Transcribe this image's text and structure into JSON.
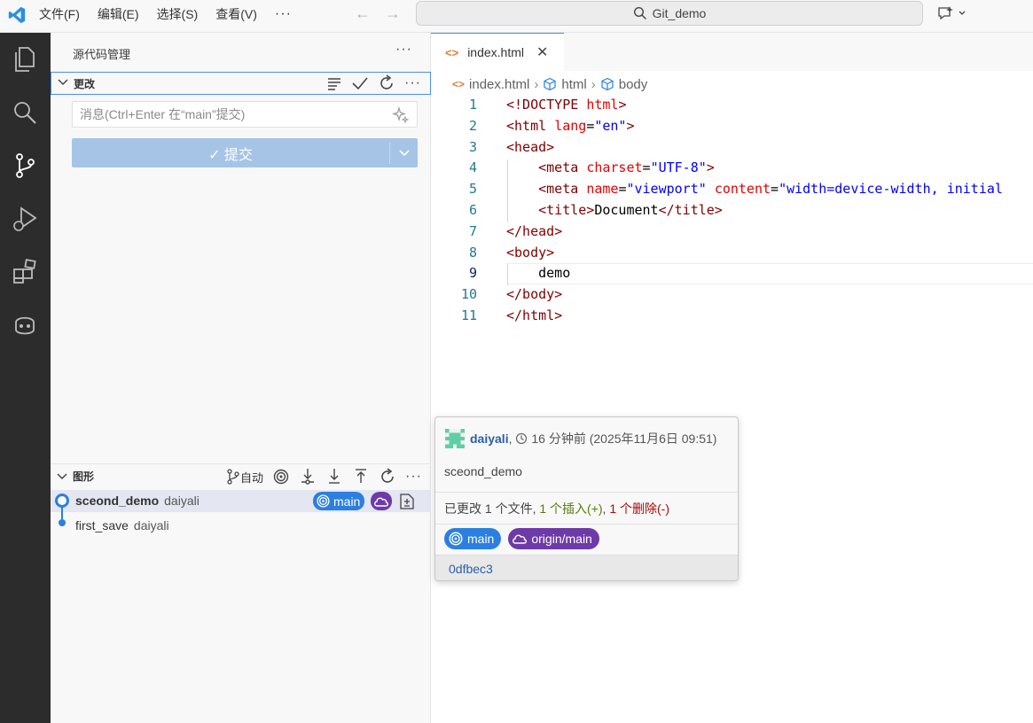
{
  "titlebar": {
    "menu": [
      "文件(F)",
      "编辑(E)",
      "选择(S)",
      "查看(V)"
    ],
    "more": "···",
    "search_text": "Git_demo"
  },
  "sidebar": {
    "title": "源代码管理",
    "more": "···",
    "changes_label": "更改",
    "message_placeholder": "消息(Ctrl+Enter 在“main”提交)",
    "commit_label": "✓ 提交",
    "graph_label": "图形",
    "graph_auto": "自动",
    "commits": [
      {
        "message": "sceond_demo",
        "author": "daiyali",
        "branch": "main"
      },
      {
        "message": "first_save",
        "author": "daiyali"
      }
    ]
  },
  "editor": {
    "tab_label": "index.html",
    "tab_close": "✕",
    "breadcrumb": [
      "index.html",
      "html",
      "body"
    ],
    "current_line": 9
  },
  "hover": {
    "author": "daiyali",
    "time": "16 分钟前 (2025年11月6日 09:51)",
    "message": "sceond_demo",
    "stats_prefix": "已更改 1 个文件, ",
    "stats_ins": "1 个插入(+)",
    "stats_sep": ", ",
    "stats_del": "1 个删除(-)",
    "badge_main": "main",
    "badge_origin": "origin/main",
    "hash": "0dfbec3"
  },
  "colors": {
    "accent": "#2b7fe0",
    "cloud": "#6e3aa8",
    "activitybar": "#2c2c2c"
  }
}
